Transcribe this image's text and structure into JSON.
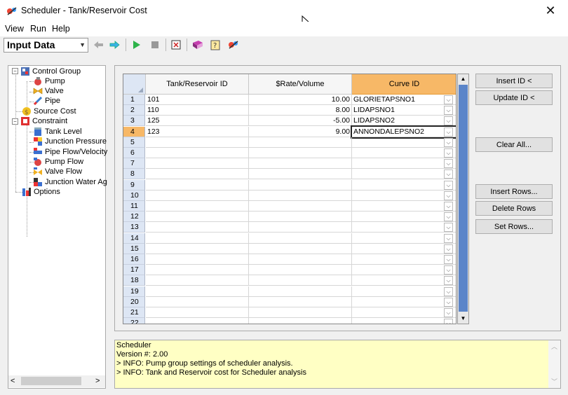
{
  "window": {
    "title": "Scheduler - Tank/Reservoir Cost",
    "close": "✕"
  },
  "menu": [
    "View",
    "Run",
    "Help"
  ],
  "toolbar": {
    "mode": "Input Data"
  },
  "tree": {
    "control_group": "Control Group",
    "pump": "Pump",
    "valve": "Valve",
    "pipe": "Pipe",
    "source_cost": "Source Cost",
    "constraint": "Constraint",
    "tank_level": "Tank Level",
    "junction_pressure": "Junction Pressure",
    "pipe_flow_velocity": "Pipe Flow/Velocity",
    "pump_flow": "Pump Flow",
    "valve_flow": "Valve Flow",
    "junction_water_age": "Junction Water Ag",
    "options": "Options"
  },
  "grid": {
    "headers": {
      "id": "Tank/Reservoir ID",
      "rate": "$Rate/Volume",
      "curve": "Curve ID"
    },
    "rows": [
      {
        "n": "1",
        "id": "101",
        "rate": "10.00",
        "curve": "GLORIETAPSNO1"
      },
      {
        "n": "2",
        "id": "110",
        "rate": "8.00",
        "curve": "LIDAPSNO1"
      },
      {
        "n": "3",
        "id": "125",
        "rate": "-5.00",
        "curve": "LIDAPSNO2"
      },
      {
        "n": "4",
        "id": "123",
        "rate": "9.00",
        "curve": "ANNONDALEPSNO2"
      },
      {
        "n": "5"
      },
      {
        "n": "6"
      },
      {
        "n": "7"
      },
      {
        "n": "8"
      },
      {
        "n": "9"
      },
      {
        "n": "10"
      },
      {
        "n": "11"
      },
      {
        "n": "12"
      },
      {
        "n": "13"
      },
      {
        "n": "14"
      },
      {
        "n": "15"
      },
      {
        "n": "16"
      },
      {
        "n": "17"
      },
      {
        "n": "18"
      },
      {
        "n": "19"
      },
      {
        "n": "20"
      },
      {
        "n": "21"
      },
      {
        "n": "22"
      }
    ],
    "selected_row": 4
  },
  "buttons": {
    "insert_id": "Insert ID <",
    "update_id": "Update ID <",
    "clear_all": "Clear All...",
    "insert_rows": "Insert Rows...",
    "delete_rows": "Delete Rows",
    "set_rows": "Set Rows..."
  },
  "log": [
    "Scheduler",
    "Version #: 2.00",
    "> INFO: Pump group settings of scheduler analysis.",
    "> INFO: Tank and Reservoir cost for Scheduler analysis"
  ],
  "colors": {
    "curve_header": "#f7b867",
    "log_bg": "#ffffc4",
    "row_header": "#dde6f4"
  }
}
